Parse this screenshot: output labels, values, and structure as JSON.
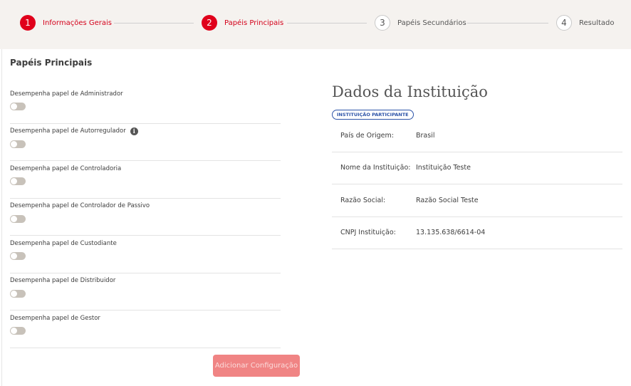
{
  "stepper": {
    "steps": [
      {
        "number": "1",
        "label": "Informações Gerais",
        "state": "active"
      },
      {
        "number": "2",
        "label": "Papéis Principais",
        "state": "active"
      },
      {
        "number": "3",
        "label": "Papéis Secundários",
        "state": "inactive"
      },
      {
        "number": "4",
        "label": "Resultado",
        "state": "inactive"
      }
    ]
  },
  "main": {
    "section_title": "Papéis Principais",
    "roles": [
      {
        "label": "Desempenha papel de Administrador",
        "enabled": false,
        "has_info": false
      },
      {
        "label": "Desempenha papel de Autorregulador",
        "enabled": false,
        "has_info": true
      },
      {
        "label": "Desempenha papel de Controladoria",
        "enabled": false,
        "has_info": false
      },
      {
        "label": "Desempenha papel de Controlador de Passivo",
        "enabled": false,
        "has_info": false
      },
      {
        "label": "Desempenha papel de Custodiante",
        "enabled": false,
        "has_info": false
      },
      {
        "label": "Desempenha papel de Distribuidor",
        "enabled": false,
        "has_info": false
      },
      {
        "label": "Desempenha papel de Gestor",
        "enabled": false,
        "has_info": false
      }
    ],
    "info_icon_glyph": "i",
    "add_button_label": "Adicionar Configuração"
  },
  "institution": {
    "title": "Dados da Instituição",
    "badge": "INSTITUIÇÃO PARTICIPANTE",
    "fields": [
      {
        "key": "País de Origem:",
        "value": "Brasil"
      },
      {
        "key": "Nome da Instituição:",
        "value": "Instituição Teste"
      },
      {
        "key": "Razão Social:",
        "value": "Razão Social Teste"
      },
      {
        "key": "CNPJ Instituição:",
        "value": "13.135.638/6614-04"
      }
    ]
  },
  "colors": {
    "accent": "#e0001b",
    "button_disabled": "#f08484",
    "badge": "#2d54a8",
    "stepper_bg": "#f5f2ef"
  }
}
